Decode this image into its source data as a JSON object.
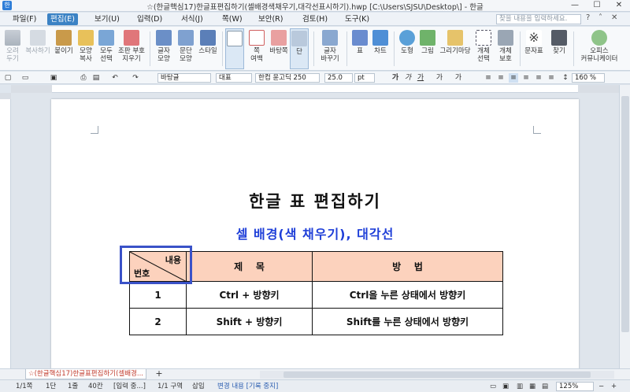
{
  "titlebar": {
    "title": "☆(한글핵심17)한글표편집하기(셀배경색채우기,대각선표시하기).hwp [C:\\Users\\SJSU\\Desktop\\] - 한글",
    "minimize": "—",
    "maximize": "☐",
    "close": "✕"
  },
  "menubar": {
    "items": [
      "파일(F)",
      "편집(E)",
      "보기(U)",
      "입력(D)",
      "서식(J)",
      "쪽(W)",
      "보안(R)",
      "검토(H)",
      "도구(K)"
    ],
    "help_placeholder": "찾을 내용을 입력하세요."
  },
  "ribbon": {
    "buttons": [
      {
        "label": "오려\n두기"
      },
      {
        "label": "복사하기"
      },
      {
        "label": "붙이기"
      },
      {
        "label": "모양\n복사"
      },
      {
        "label": "모두\n선택"
      },
      {
        "label": "조판 부호\n지우기"
      },
      {
        "label": "글자\n모양"
      },
      {
        "label": "문단\n모양"
      },
      {
        "label": "스타일"
      },
      {
        "label": ""
      },
      {
        "label": "쪽\n여백"
      },
      {
        "label": "바탕쪽"
      },
      {
        "label": "단"
      },
      {
        "label": "글자\n바꾸기"
      },
      {
        "label": "표"
      },
      {
        "label": "차트"
      },
      {
        "label": "도형"
      },
      {
        "label": "그림"
      },
      {
        "label": "그리기마당"
      },
      {
        "label": "개체\n선택"
      },
      {
        "label": "개체\n보호"
      },
      {
        "label": "문자표"
      },
      {
        "label": "찾기"
      },
      {
        "label": "오피스\n커뮤니케이터"
      }
    ]
  },
  "format": {
    "style": "바탕글",
    "lang": "대표",
    "font": "한컴 윤고딕 250",
    "size": "25.0",
    "unit": "pt",
    "zoom": "160 %"
  },
  "document": {
    "title": "한글 표 편집하기",
    "subtitle": "셀 배경(색 채우기), 대각선",
    "table": {
      "diag_top": "내용",
      "diag_bottom": "번호",
      "headers": [
        "제    목",
        "방    법"
      ],
      "rows": [
        [
          "1",
          "Ctrl + 방향키",
          "Ctrl을 누른 상태에서 방향키"
        ],
        [
          "2",
          "Shift + 방향키",
          "Shift를 누른 상태에서 방향키"
        ]
      ]
    }
  },
  "tabs": {
    "doc_tab": "☆(한글핵심17)한글표편집하기(셀배경...",
    "add": "+"
  },
  "status": {
    "page": "1/1쪽",
    "col": "1단",
    "line": "1줄",
    "char": "40칸",
    "input": "[입력 중...]",
    "section": "1/1 구역",
    "mode": "삽입",
    "track": "변경 내용 [기록 중지]",
    "zoom": "125%"
  },
  "colors": {
    "header_fill": "#fcd2bd",
    "subtitle": "#1f3fd8",
    "highlight_box": "#3a52c8",
    "active_menu": "#3b82c4"
  }
}
